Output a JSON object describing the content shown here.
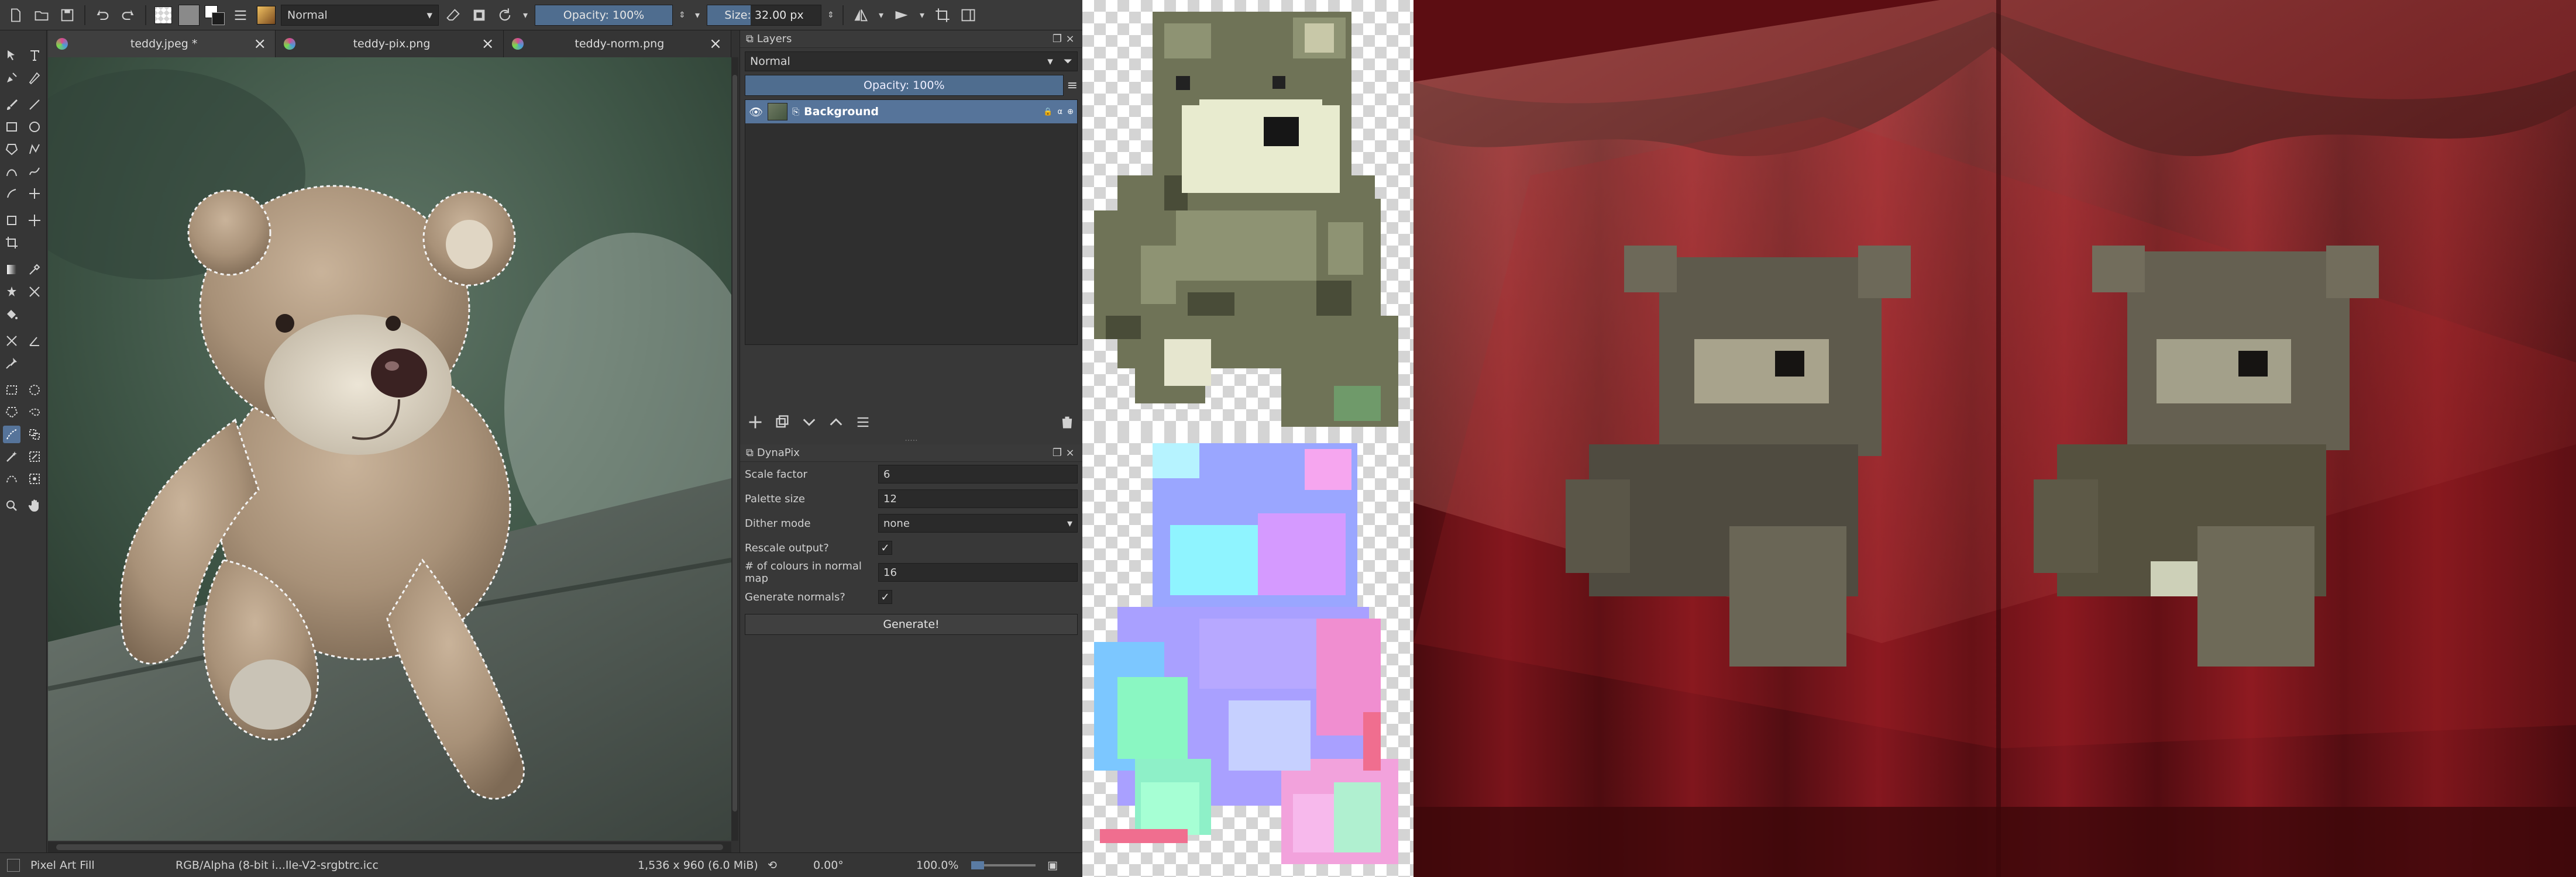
{
  "toolbar": {
    "blend_mode": "Normal",
    "opacity": "Opacity: 100%",
    "opacity_level": 1.0,
    "size": "Size: 32.00 px",
    "size_level": 0.38,
    "colors": {
      "foreground": "#2b2b2b",
      "background": "#ffffff",
      "accent": "#56749a"
    }
  },
  "tabs": [
    {
      "label": "teddy.jpeg *",
      "close": "×"
    },
    {
      "label": "teddy-pix.png",
      "close": "×"
    },
    {
      "label": "teddy-norm.png",
      "close": "×"
    }
  ],
  "layers_docker": {
    "title": "Layers",
    "blend_mode": "Normal",
    "opacity": "Opacity:  100%",
    "layer": {
      "name": "Background"
    }
  },
  "dynapix_docker": {
    "title": "DynaPix",
    "fields": [
      {
        "label": "Scale factor",
        "value": "6"
      },
      {
        "label": "Palette size",
        "value": "12"
      },
      {
        "label": "Dither mode",
        "value": "none"
      },
      {
        "label": "Rescale output?",
        "value": "✓"
      },
      {
        "label": "# of colours in normal map",
        "value": "16"
      },
      {
        "label": "Generate normals?",
        "value": "✓"
      }
    ],
    "generate_label": "Generate!"
  },
  "statusbar": {
    "tool": "Pixel Art Fill",
    "color_profile": "RGB/Alpha (8-bit i...lle-V2-srgbtrc.icc",
    "dimensions": "1,536 x 960 (6.0 MiB)",
    "rotation": "0.00°",
    "zoom": "100.0%"
  },
  "images": {
    "canvas": "teddy bear photo",
    "pixel_art": "pixelated teddy bear",
    "normal_map": "teddy bear normal map",
    "stage": "lit pixel-art teddy bears on red curtain stage"
  }
}
